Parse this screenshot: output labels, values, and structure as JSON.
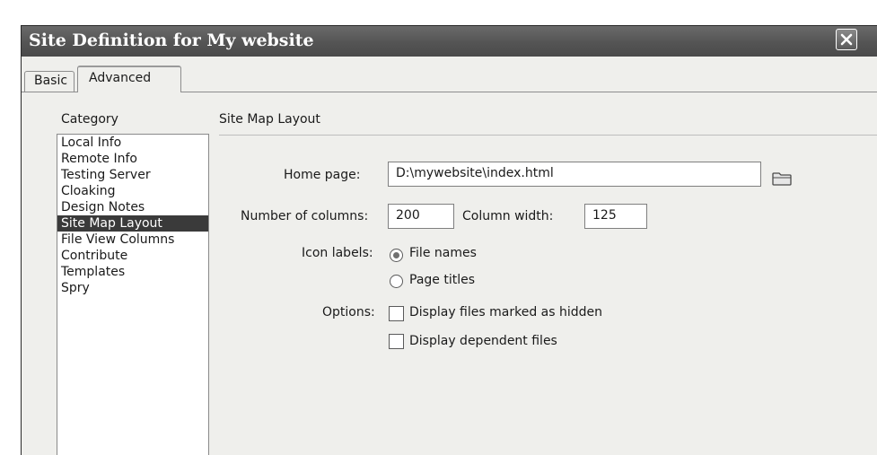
{
  "window": {
    "title": "Site Definition for My website",
    "close_icon": "close-icon"
  },
  "tabs": [
    {
      "label": "Basic",
      "active": false
    },
    {
      "label": "Advanced",
      "active": true
    }
  ],
  "category": {
    "label": "Category",
    "items": [
      "Local Info",
      "Remote Info",
      "Testing Server",
      "Cloaking",
      "Design Notes",
      "Site Map Layout",
      "File View Columns",
      "Contribute",
      "Templates",
      "Spry"
    ],
    "selected": "Site Map Layout"
  },
  "panel": {
    "title": "Site Map Layout",
    "home_page": {
      "label": "Home page:",
      "value": "D:\\mywebsite\\index.html",
      "browse_icon": "folder-icon"
    },
    "columns": {
      "label": "Number of columns:",
      "value": "200"
    },
    "column_width": {
      "label": "Column width:",
      "value": "125"
    },
    "icon_labels": {
      "label": "Icon labels:",
      "options": [
        {
          "label": "File names",
          "checked": true
        },
        {
          "label": "Page titles",
          "checked": false
        }
      ]
    },
    "options": {
      "label": "Options:",
      "items": [
        {
          "label": "Display files marked as hidden",
          "checked": false
        },
        {
          "label": "Display dependent files",
          "checked": false
        }
      ]
    }
  }
}
